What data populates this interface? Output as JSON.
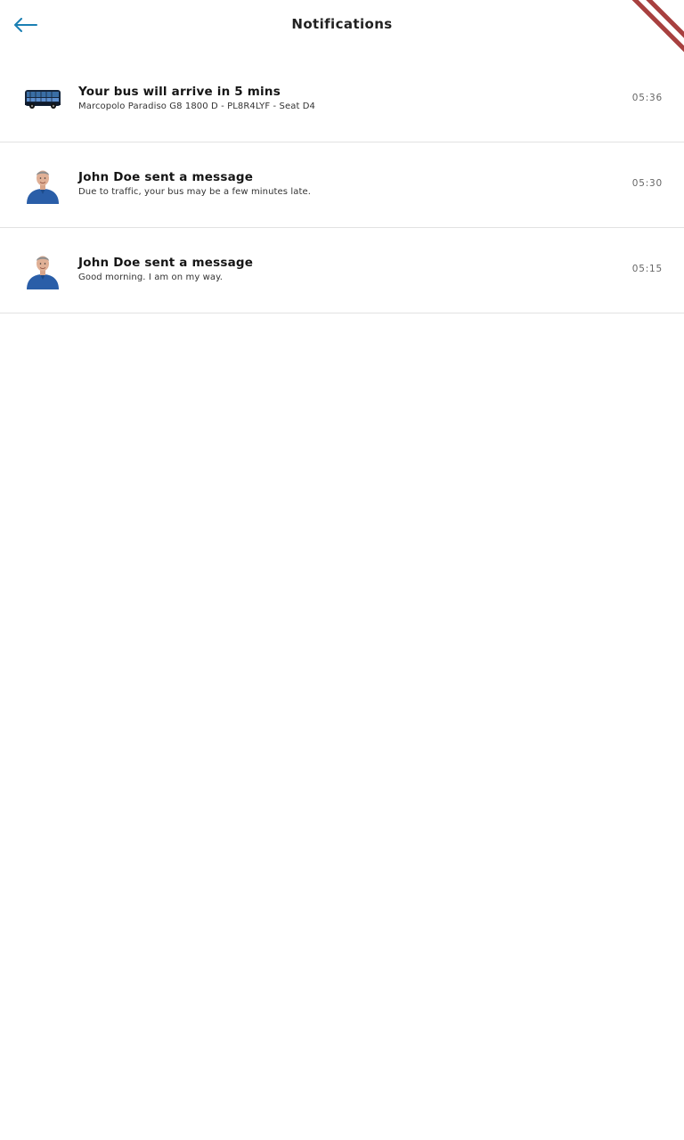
{
  "header": {
    "title": "Notifications",
    "back_icon": "arrow-left-icon",
    "accent_color": "#1a7fb3"
  },
  "notifications": [
    {
      "title": "Your bus will arrive in 5 mins",
      "subtitle": "Marcopolo Paradiso G8 1800 D - PL8R4LYF - Seat D4",
      "time": "05:36",
      "thumb": "bus-image"
    },
    {
      "title": "John Doe sent a message",
      "subtitle": "Due to traffic, your bus may be a few minutes late.",
      "time": "05:30",
      "thumb": "avatar-image"
    },
    {
      "title": "John Doe sent a message",
      "subtitle": "Good morning. I am on my way.",
      "time": "05:15",
      "thumb": "avatar-image"
    }
  ],
  "debug_banner_color": "#a8403f"
}
